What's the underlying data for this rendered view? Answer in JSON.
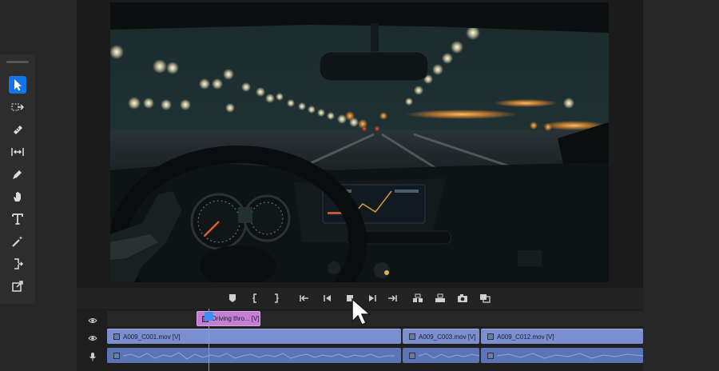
{
  "tools": [
    {
      "name": "selection-tool",
      "active": true
    },
    {
      "name": "track-select-forward-tool",
      "active": false
    },
    {
      "name": "ripple-edit-tool",
      "active": false
    },
    {
      "name": "slip-tool",
      "active": false
    },
    {
      "name": "pen-tool",
      "active": false
    },
    {
      "name": "hand-tool",
      "active": false
    },
    {
      "name": "type-tool",
      "active": false
    },
    {
      "name": "magic-wand-tool",
      "active": false
    },
    {
      "name": "track-select-tool",
      "active": false
    },
    {
      "name": "export-frame-tool",
      "active": false
    }
  ],
  "transport": [
    "marker-icon",
    "mark-in-icon",
    "mark-out-icon",
    "go-to-in-icon",
    "step-back-icon",
    "stop-icon",
    "step-forward-icon",
    "go-to-out-icon",
    "insert-icon",
    "overwrite-icon",
    "export-frame-icon",
    "compare-icon"
  ],
  "timeline": {
    "title_clip": {
      "label": "Driving thro... [V]"
    },
    "video_clips": [
      {
        "label": "A009_C001.mov [V]"
      },
      {
        "label": "A009_C003.mov [V]"
      },
      {
        "label": "A009_C012.mov [V]"
      }
    ]
  },
  "colors": {
    "accent": "#1473e6",
    "title_clip": "#c37fd1",
    "video_clip": "#7b8fd0",
    "audio_clip": "#5b74b8",
    "playhead": "#5aa8ff"
  }
}
